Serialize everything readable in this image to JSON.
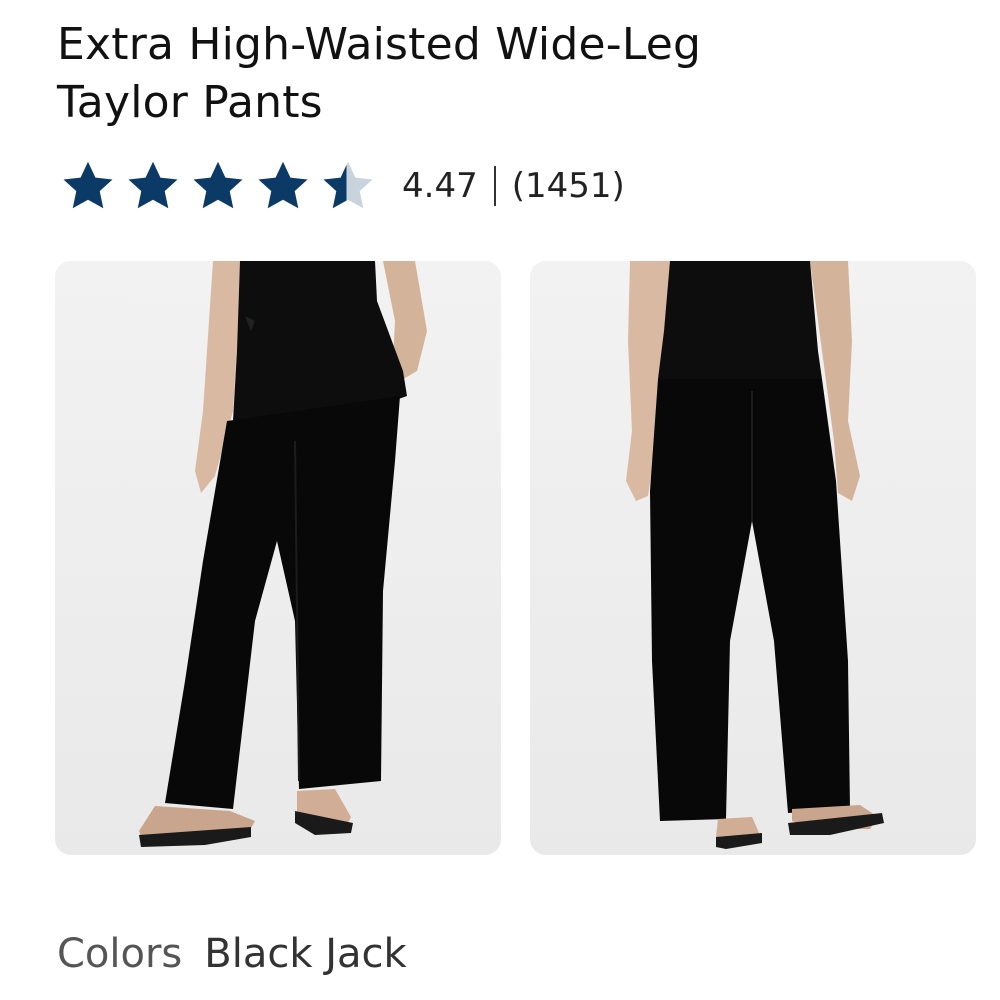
{
  "product": {
    "title_line1": "Extra High-Waisted Wide-Leg",
    "title_line2": "Taylor Pants"
  },
  "rating": {
    "stars_filled": 4.47,
    "stars_total": 5,
    "value_text": "4.47",
    "count_text": "(1451)",
    "star_color": "#0b3a66",
    "star_empty_color": "#c9d3de"
  },
  "gallery": {
    "images": [
      {
        "view": "front"
      },
      {
        "view": "back"
      }
    ]
  },
  "colors": {
    "label": "Colors",
    "selected": "Black Jack"
  }
}
